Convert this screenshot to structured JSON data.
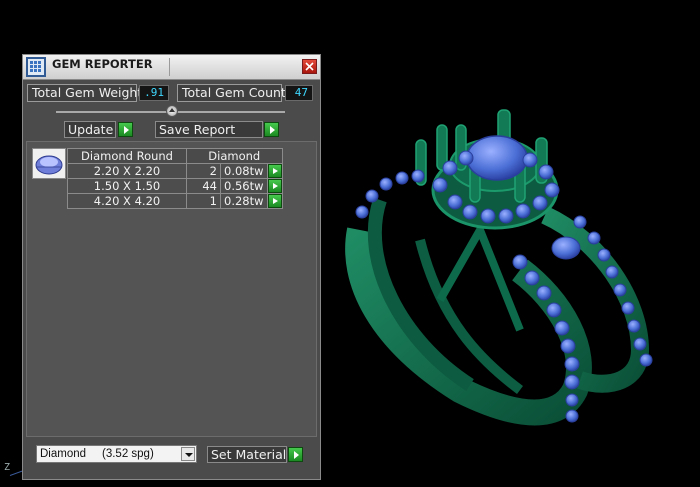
{
  "panel": {
    "title": "GEM REPORTER",
    "total_weight_label": "Total Gem Weight",
    "total_weight_value": ".91",
    "total_count_label": "Total Gem Count",
    "total_count_value": "47",
    "update_label": "Update",
    "save_report_label": "Save Report",
    "table": {
      "headers": [
        "Diamond Round",
        "Diamond"
      ],
      "rows": [
        {
          "size": "2.20 X 2.20",
          "count": "2",
          "tw": "0.08tw"
        },
        {
          "size": "1.50 X 1.50",
          "count": "44",
          "tw": "0.56tw"
        },
        {
          "size": "4.20 X 4.20",
          "count": "1",
          "tw": "0.28tw"
        }
      ]
    },
    "material_select": "Diamond     (3.52 spg)",
    "set_material_label": "Set Material"
  },
  "viewport": {
    "axis_label": "Z",
    "ring_color": "#0f6f4e",
    "gem_color": "#4b6fd6"
  }
}
